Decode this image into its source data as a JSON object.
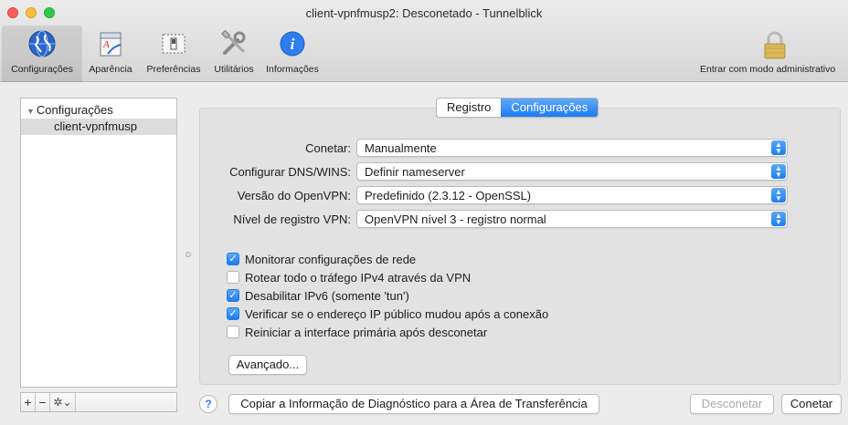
{
  "window": {
    "title": "client-vpnfmusp2: Desconetado - Tunnelblick"
  },
  "toolbar": {
    "items": [
      {
        "label": "Configurações",
        "icon": "configurations-globe-icon"
      },
      {
        "label": "Aparência",
        "icon": "appearance-icon"
      },
      {
        "label": "Preferências",
        "icon": "preferences-switch-icon"
      },
      {
        "label": "Utilitários",
        "icon": "utilities-tools-icon"
      },
      {
        "label": "Informações",
        "icon": "info-icon"
      }
    ],
    "admin_label": "Entrar com modo administrativo"
  },
  "sidebar": {
    "header": "Configurações",
    "items": [
      {
        "label": "client-vpnfmusp"
      }
    ],
    "buttons": {
      "add": "+",
      "remove": "−",
      "gear": "✲⌄"
    }
  },
  "tabs": {
    "registro": "Registro",
    "configuracoes": "Configurações",
    "active": "Configurações"
  },
  "settings": {
    "rows": [
      {
        "label": "Conetar:",
        "value": "Manualmente"
      },
      {
        "label": "Configurar DNS/WINS:",
        "value": "Definir nameserver"
      },
      {
        "label": "Versão do OpenVPN:",
        "value": "Predefinido (2.3.12 - OpenSSL)"
      },
      {
        "label": "Nível de registro VPN:",
        "value": "OpenVPN nível 3 - registro normal"
      }
    ],
    "checkboxes": [
      {
        "label": "Monitorar configurações de rede",
        "checked": true
      },
      {
        "label": "Rotear todo o tráfego IPv4 através da VPN",
        "checked": false
      },
      {
        "label": "Desabilitar IPv6 (somente 'tun')",
        "checked": true
      },
      {
        "label": "Verificar se o endereço IP público mudou após a conexão",
        "checked": true
      },
      {
        "label": "Reiniciar a interface primária após desconetar",
        "checked": false
      }
    ],
    "advanced_label": "Avançado..."
  },
  "footer": {
    "help": "?",
    "copy_label": "Copiar a Informação de Diagnóstico para a Área de Transferência",
    "disconnect_label": "Desconetar",
    "connect_label": "Conetar"
  },
  "colors": {
    "accent": "#1d7cf2",
    "panel": "#e2e2e2"
  }
}
